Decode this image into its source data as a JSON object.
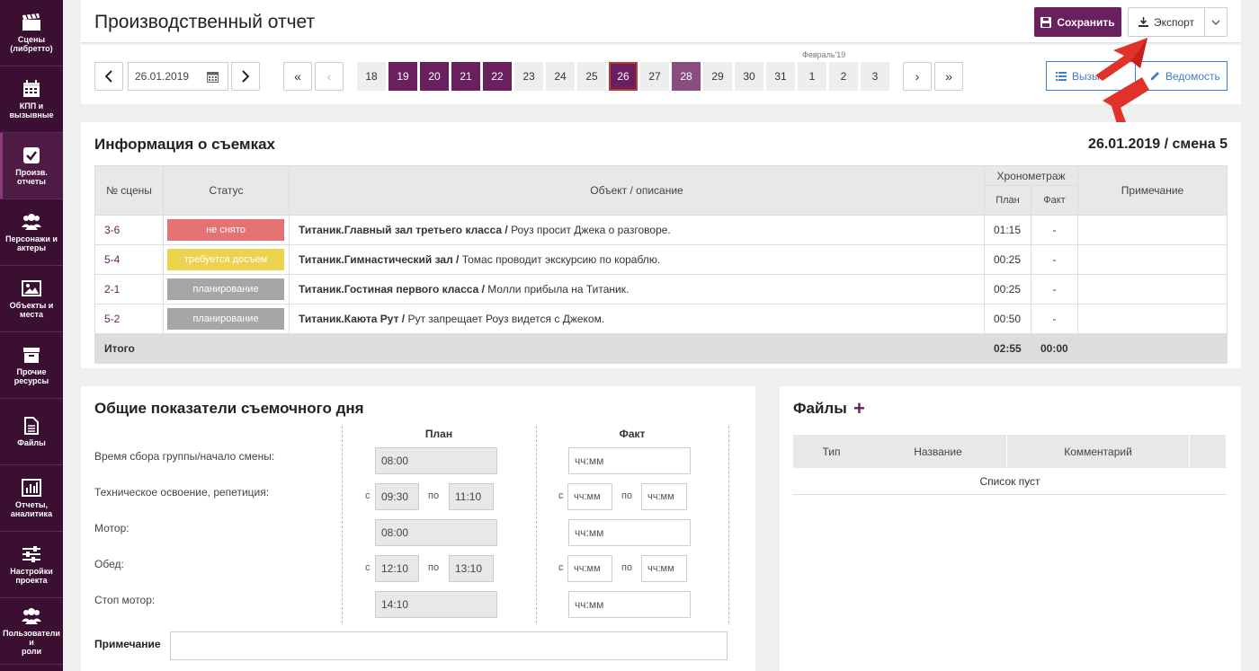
{
  "sidebar": {
    "items": [
      {
        "label": "Сцены\n(либретто)",
        "icon": "clapperboard-icon"
      },
      {
        "label": "КПП и\nвызывные",
        "icon": "calendar-icon"
      },
      {
        "label": "Произв.\nотчеты",
        "icon": "checkbox-icon",
        "active": true
      },
      {
        "label": "Персонажи и\nактеры",
        "icon": "people-icon"
      },
      {
        "label": "Объекты и\nместа",
        "icon": "image-icon"
      },
      {
        "label": "Прочие\nресурсы",
        "icon": "archive-icon"
      },
      {
        "label": "Файлы",
        "icon": "file-icon"
      },
      {
        "label": "Отчеты,\nаналитика",
        "icon": "bar-chart-icon"
      },
      {
        "label": "Настройки\nпроекта",
        "icon": "sliders-icon"
      },
      {
        "label": "Пользователи и\nроли",
        "icon": "users-icon"
      }
    ]
  },
  "header": {
    "title": "Производственный отчет",
    "save_label": "Сохранить",
    "export_label": "Экспорт"
  },
  "datenav": {
    "date": "26.01.2019",
    "first": "«",
    "prev": "‹",
    "next": "›",
    "last": "»",
    "month_label": "Февраль'19",
    "days": [
      {
        "d": "18",
        "s": ""
      },
      {
        "d": "19",
        "s": "p"
      },
      {
        "d": "20",
        "s": "p"
      },
      {
        "d": "21",
        "s": "p"
      },
      {
        "d": "22",
        "s": "p"
      },
      {
        "d": "23",
        "s": ""
      },
      {
        "d": "24",
        "s": ""
      },
      {
        "d": "25",
        "s": ""
      },
      {
        "d": "26",
        "s": "cur"
      },
      {
        "d": "27",
        "s": ""
      },
      {
        "d": "28",
        "s": "pl"
      },
      {
        "d": "29",
        "s": ""
      },
      {
        "d": "30",
        "s": ""
      },
      {
        "d": "31",
        "s": ""
      },
      {
        "d": "1",
        "s": ""
      },
      {
        "d": "2",
        "s": ""
      },
      {
        "d": "3",
        "s": ""
      }
    ],
    "callsheet_label": "Вызы",
    "statement_label": "Ведомость"
  },
  "shooting": {
    "title": "Информация о съемках",
    "shift": "26.01.2019 / смена 5",
    "headers": {
      "scene": "№ сцены",
      "status": "Статус",
      "object": "Объект / описание",
      "chrono": "Хронометраж",
      "plan": "План",
      "fact": "Факт",
      "note": "Примечание"
    },
    "rows": [
      {
        "scene": "3-6",
        "status": "не снято",
        "color": "#e57373",
        "obj": "Титаник.Главный зал третьего класса /",
        "desc": " Роуз просит Джека о разговоре.",
        "plan": "01:15",
        "fact": "-"
      },
      {
        "scene": "5-4",
        "status": "требуется досъем",
        "color": "#ecd34d",
        "obj": "Титаник.Гимнастический зал /",
        "desc": " Томас проводит экскурсию по кораблю.",
        "plan": "00:25",
        "fact": "-"
      },
      {
        "scene": "2-1",
        "status": "планирование",
        "color": "#a6a6a6",
        "obj": "Титаник.Гостиная первого класса /",
        "desc": " Молли прибыла на Титаник.",
        "plan": "00:25",
        "fact": "-"
      },
      {
        "scene": "5-2",
        "status": "планирование",
        "color": "#a6a6a6",
        "obj": "Титаник.Каюта Рут /",
        "desc": " Рут запрещает Роуз видется с Джеком.",
        "plan": "00:50",
        "fact": "-"
      }
    ],
    "total": {
      "label": "Итого",
      "plan": "02:55",
      "fact": "00:00"
    }
  },
  "indicators": {
    "title": "Общие показатели съемочного дня",
    "plan_head": "План",
    "fact_head": "Факт",
    "c": "с",
    "po": "по",
    "ph": "чч:мм",
    "labels": [
      "Время сбора группы/начало смены:",
      "Техническое освоение, репетиция:",
      "Мотор:",
      "Обед:",
      "Стоп мотор:"
    ],
    "plan": {
      "gather": "08:00",
      "tech_from": "09:30",
      "tech_to": "11:10",
      "motor": "08:00",
      "lunch_from": "12:10",
      "lunch_to": "13:10",
      "stop": "14:10"
    },
    "note_label": "Примечание"
  },
  "files": {
    "title": "Файлы",
    "add": "+",
    "headers": {
      "type": "Тип",
      "name": "Название",
      "comment": "Комментарий"
    },
    "empty": "Список пуст"
  }
}
